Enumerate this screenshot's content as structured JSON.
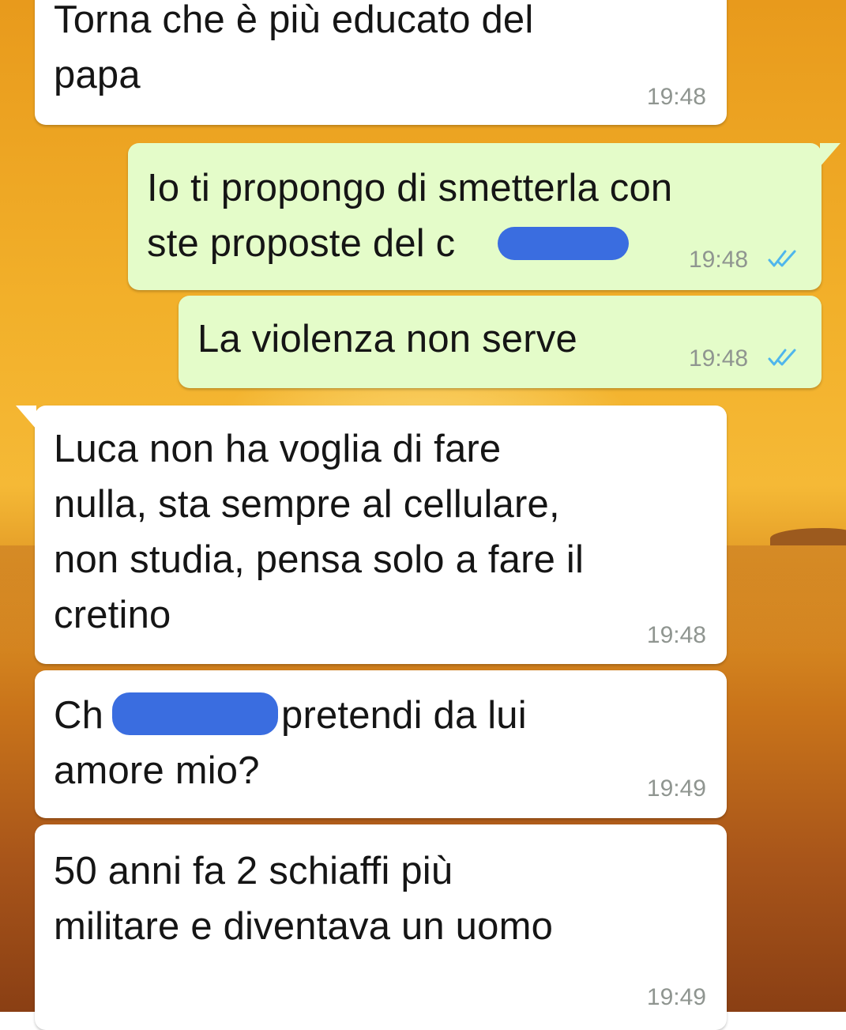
{
  "messages": [
    {
      "direction": "incoming",
      "lines": [
        "Torna che è più educato del",
        "papa"
      ],
      "time": "19:48"
    },
    {
      "direction": "outgoing",
      "lines": [
        "Io ti propongo di smetterla con",
        "ste proposte del c"
      ],
      "time": "19:48",
      "status": "read"
    },
    {
      "direction": "outgoing",
      "lines": [
        "La violenza non serve"
      ],
      "time": "19:48",
      "status": "read"
    },
    {
      "direction": "incoming",
      "lines": [
        "Luca non ha voglia di fare",
        "nulla, sta sempre al cellulare,",
        "non studia, pensa solo a fare il",
        "cretino"
      ],
      "time": "19:48"
    },
    {
      "direction": "incoming",
      "lines": [
        "Ch",
        "pretendi da lui",
        "amore mio?"
      ],
      "time": "19:49"
    },
    {
      "direction": "incoming",
      "lines": [
        "50 anni fa 2 schiaffi più",
        "militare e diventava un uomo"
      ],
      "time": "19:49"
    }
  ],
  "colors": {
    "incoming_bubble": "#ffffff",
    "outgoing_bubble": "#e4fcc9",
    "read_ticks": "#4fb6ec",
    "censor_mark": "#3a6de0"
  },
  "icons": {
    "read_status": "double-check-icon"
  }
}
